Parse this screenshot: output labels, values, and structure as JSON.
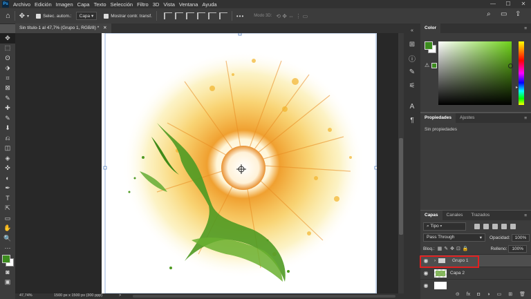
{
  "menu": {
    "logo": "Ps",
    "items": [
      "Archivo",
      "Edición",
      "Imagen",
      "Capa",
      "Texto",
      "Selección",
      "Filtro",
      "3D",
      "Vista",
      "Ventana",
      "Ayuda"
    ],
    "window_controls": [
      "—",
      "☐",
      "✕"
    ]
  },
  "options": {
    "home": "⌂",
    "auto_select_label": "Selec. autom.:",
    "auto_select_value": "Capa",
    "transform_label": "Mostrar contr. transf.",
    "more": "•••",
    "mode3d": "Modo 3D:"
  },
  "document": {
    "tab_title": "Sin título-1 al 47,7% (Grupo 1, RGB/8) *",
    "tab_close": "✕",
    "zoom": "47,74%",
    "size_info": "1500 px x 1500 px (300 ppp)",
    "status_arrow": ">"
  },
  "tools": [
    "✥",
    "⬚",
    "ʘ",
    "⬗",
    "⌗",
    "⊠",
    "✎",
    "✚",
    "✎",
    "⬇",
    "⎌",
    "◫",
    "◈",
    "✜",
    "◐",
    "✒",
    "T",
    "⇱",
    "▭",
    "✋",
    "🔍",
    "⋯"
  ],
  "color_panel": {
    "title": "Color",
    "fg": "#3c8c1e",
    "bg": "#ffffff",
    "hue_top": "#9bdd1f"
  },
  "properties_panel": {
    "tabs": [
      "Propiedades",
      "Ajustes"
    ],
    "active": "Propiedades",
    "empty_text": "Sin propiedades"
  },
  "layers_panel": {
    "tabs": [
      "Capas",
      "Canales",
      "Trazados"
    ],
    "active": "Capas",
    "filter_label": "Tipo",
    "blend_mode": "Pass Through",
    "opacity_label": "Opacidad:",
    "opacity_value": "100%",
    "lock_label": "Bloq.:",
    "fill_label": "Relleno:",
    "fill_value": "100%",
    "layers": [
      {
        "name": "Grupo 1",
        "type": "group",
        "selected": true
      },
      {
        "name": "Capa 2",
        "type": "pixel",
        "selected": false
      },
      {
        "name": "",
        "type": "fill",
        "selected": false
      }
    ],
    "footer_icons": [
      "link-icon",
      "fx-icon",
      "mask-icon",
      "adjustment-icon",
      "folder-icon",
      "new-layer-icon",
      "trash-icon"
    ],
    "footer_glyphs": [
      "⊝",
      "fx",
      "◘",
      "◑",
      "▭",
      "⊞",
      "🗑"
    ]
  },
  "highlight_color": "#e02020"
}
